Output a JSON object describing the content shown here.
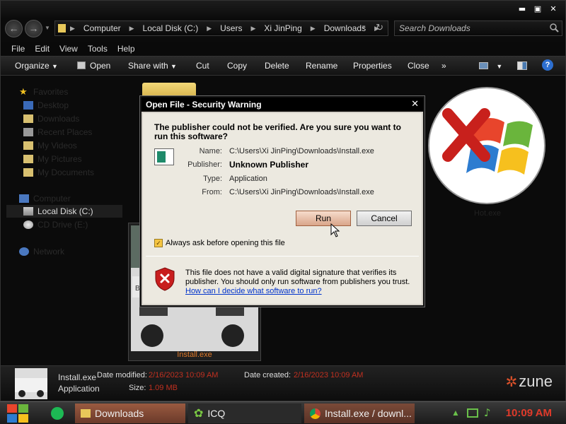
{
  "address": {
    "crumbs": [
      "Computer",
      "Local Disk (C:)",
      "Users",
      "Xi JinPing",
      "Downloads"
    ],
    "search_placeholder": "Search Downloads"
  },
  "menu": [
    "File",
    "Edit",
    "View",
    "Tools",
    "Help"
  ],
  "toolbar": {
    "organize": "Organize",
    "open": "Open",
    "share": "Share with",
    "cut": "Cut",
    "copy": "Copy",
    "delete": "Delete",
    "rename": "Rename",
    "properties": "Properties",
    "close": "Close",
    "more": "»"
  },
  "sidebar": {
    "favorites": "Favorites",
    "items": [
      "Desktop",
      "Downloads",
      "Recent Places",
      "My Videos",
      "My Pictures",
      "My Documents"
    ],
    "computer": "Computer",
    "drives": [
      "Local Disk (C:)",
      "CD Drive (E:)"
    ],
    "network": "Network"
  },
  "files": {
    "install_label": "Install.exe",
    "hotexe_label": "Hot.exe"
  },
  "details": {
    "name": "Install.exe",
    "type": "Application",
    "modified_label": "Date modified:",
    "modified": "2/16/2023 10:09 AM",
    "created_label": "Date created:",
    "created": "2/16/2023 10:09 AM",
    "size_label": "Size:",
    "size": "1.09 MB",
    "brand": "zune"
  },
  "dialog": {
    "title": "Open File - Security Warning",
    "question": "The publisher could not be verified.  Are you sure you want to run this software?",
    "name_label": "Name:",
    "name": "C:\\Users\\Xi JinPing\\Downloads\\Install.exe",
    "publisher_label": "Publisher:",
    "publisher": "Unknown Publisher",
    "type_label": "Type:",
    "type": "Application",
    "from_label": "From:",
    "from": "C:\\Users\\Xi JinPing\\Downloads\\Install.exe",
    "run": "Run",
    "cancel": "Cancel",
    "checkbox": "Always ask before opening this file",
    "checked": true,
    "warning": "This file does not have a valid digital signature that verifies its publisher.  You should only run software from publishers you trust.",
    "link": "How can I decide what software to run?"
  },
  "taskbar": {
    "tasks": [
      "Downloads",
      "ICQ",
      "Install.exe / downl..."
    ],
    "clock": "10:09 AM"
  },
  "colors": {
    "accent_red": "#c03020",
    "clock_red": "#e03a2a",
    "dialog_bg": "#ece9e0"
  }
}
